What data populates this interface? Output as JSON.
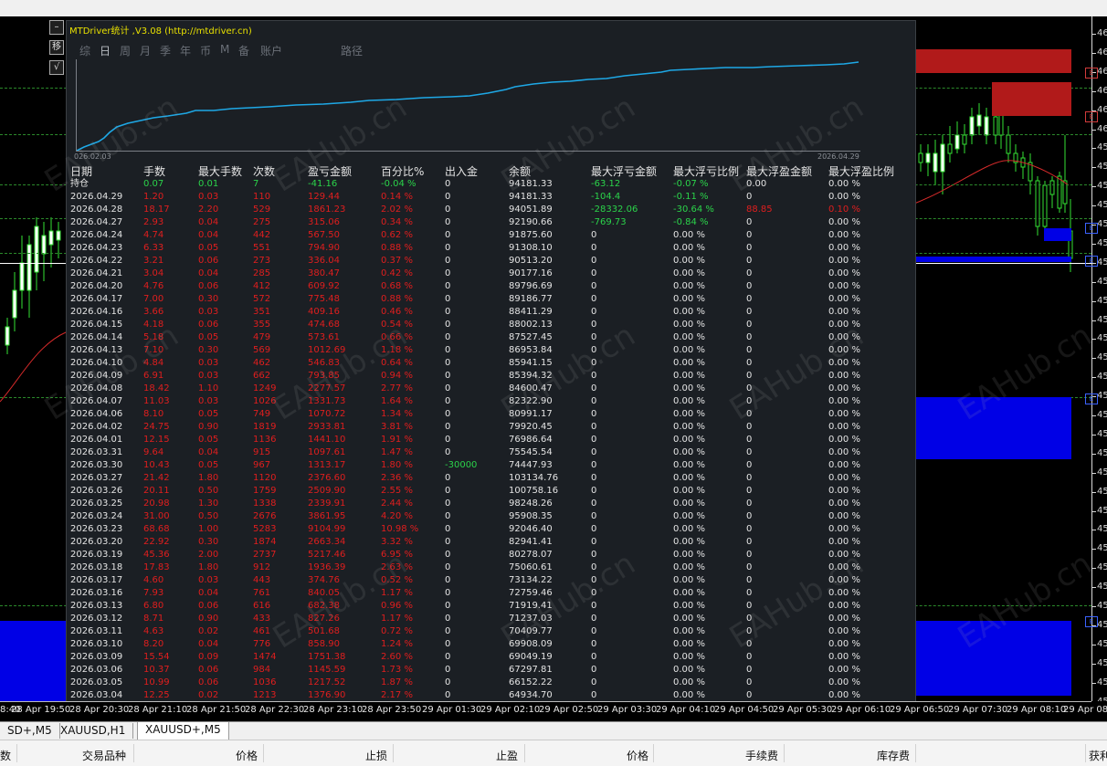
{
  "panel": {
    "title": "MTDriver统计 ,V3.08 (http://mtdriver.cn)",
    "menu": [
      "综",
      "日",
      "周",
      "月",
      "季",
      "年",
      "币",
      "M",
      "备",
      "账户",
      "路径"
    ],
    "active_menu": 1,
    "curve_start": "026.02.03",
    "curve_end": "2026.04.29",
    "curve_color": "#1ea8e6"
  },
  "side_buttons": [
    "–",
    "移",
    "√"
  ],
  "table": {
    "headers": [
      "日期",
      "手数",
      "最大手数",
      "次数",
      "盈亏金额",
      "百分比%",
      "出入金",
      "余额",
      "最大浮亏金额",
      "最大浮亏比例",
      "最大浮盈金额",
      "最大浮盈比例"
    ],
    "rows": [
      {
        "c": [
          "持仓",
          "0.07",
          "0.01",
          "7",
          "-41.16",
          "-0.04 %",
          "0",
          "94181.33",
          "-63.12",
          "-0.07 %",
          "0.00",
          "0.00 %"
        ],
        "k": [
          "w",
          "g",
          "g",
          "g",
          "g",
          "g",
          "w",
          "w",
          "g",
          "g",
          "w",
          "w"
        ]
      },
      {
        "c": [
          "2026.04.29",
          "1.20",
          "0.03",
          "110",
          "129.44",
          "0.14 %",
          "0",
          "94181.33",
          "-104.4",
          "-0.11 %",
          "0",
          "0.00 %"
        ],
        "k": [
          "w",
          "r",
          "r",
          "r",
          "r",
          "r",
          "w",
          "w",
          "g",
          "g",
          "w",
          "w"
        ]
      },
      {
        "c": [
          "2026.04.28",
          "18.17",
          "2.20",
          "529",
          "1861.23",
          "2.02 %",
          "0",
          "94051.89",
          "-28332.06",
          "-30.64 %",
          "88.85",
          "0.10 %"
        ],
        "k": [
          "w",
          "r",
          "r",
          "r",
          "r",
          "r",
          "w",
          "w",
          "g",
          "g",
          "r",
          "r"
        ]
      },
      {
        "c": [
          "2026.04.27",
          "2.93",
          "0.04",
          "275",
          "315.06",
          "0.34 %",
          "0",
          "92190.66",
          "-769.73",
          "-0.84 %",
          "0",
          "0.00 %"
        ],
        "k": [
          "w",
          "r",
          "r",
          "r",
          "r",
          "r",
          "w",
          "w",
          "g",
          "g",
          "w",
          "w"
        ]
      },
      {
        "c": [
          "2026.04.24",
          "4.74",
          "0.04",
          "442",
          "567.50",
          "0.62 %",
          "0",
          "91875.60",
          "0",
          "0.00 %",
          "0",
          "0.00 %"
        ]
      },
      {
        "c": [
          "2026.04.23",
          "6.33",
          "0.05",
          "551",
          "794.90",
          "0.88 %",
          "0",
          "91308.10",
          "0",
          "0.00 %",
          "0",
          "0.00 %"
        ]
      },
      {
        "c": [
          "2026.04.22",
          "3.21",
          "0.06",
          "273",
          "336.04",
          "0.37 %",
          "0",
          "90513.20",
          "0",
          "0.00 %",
          "0",
          "0.00 %"
        ]
      },
      {
        "c": [
          "2026.04.21",
          "3.04",
          "0.04",
          "285",
          "380.47",
          "0.42 %",
          "0",
          "90177.16",
          "0",
          "0.00 %",
          "0",
          "0.00 %"
        ]
      },
      {
        "c": [
          "2026.04.20",
          "4.76",
          "0.06",
          "412",
          "609.92",
          "0.68 %",
          "0",
          "89796.69",
          "0",
          "0.00 %",
          "0",
          "0.00 %"
        ]
      },
      {
        "c": [
          "2026.04.17",
          "7.00",
          "0.30",
          "572",
          "775.48",
          "0.88 %",
          "0",
          "89186.77",
          "0",
          "0.00 %",
          "0",
          "0.00 %"
        ]
      },
      {
        "c": [
          "2026.04.16",
          "3.66",
          "0.03",
          "351",
          "409.16",
          "0.46 %",
          "0",
          "88411.29",
          "0",
          "0.00 %",
          "0",
          "0.00 %"
        ]
      },
      {
        "c": [
          "2026.04.15",
          "4.18",
          "0.06",
          "355",
          "474.68",
          "0.54 %",
          "0",
          "88002.13",
          "0",
          "0.00 %",
          "0",
          "0.00 %"
        ]
      },
      {
        "c": [
          "2026.04.14",
          "5.18",
          "0.05",
          "479",
          "573.61",
          "0.66 %",
          "0",
          "87527.45",
          "0",
          "0.00 %",
          "0",
          "0.00 %"
        ]
      },
      {
        "c": [
          "2026.04.13",
          "7.10",
          "0.30",
          "569",
          "1012.69",
          "1.18 %",
          "0",
          "86953.84",
          "0",
          "0.00 %",
          "0",
          "0.00 %"
        ]
      },
      {
        "c": [
          "2026.04.10",
          "4.84",
          "0.03",
          "462",
          "546.83",
          "0.64 %",
          "0",
          "85941.15",
          "0",
          "0.00 %",
          "0",
          "0.00 %"
        ]
      },
      {
        "c": [
          "2026.04.09",
          "6.91",
          "0.03",
          "662",
          "793.85",
          "0.94 %",
          "0",
          "85394.32",
          "0",
          "0.00 %",
          "0",
          "0.00 %"
        ]
      },
      {
        "c": [
          "2026.04.08",
          "18.42",
          "1.10",
          "1249",
          "2277.57",
          "2.77 %",
          "0",
          "84600.47",
          "0",
          "0.00 %",
          "0",
          "0.00 %"
        ]
      },
      {
        "c": [
          "2026.04.07",
          "11.03",
          "0.03",
          "1026",
          "1331.73",
          "1.64 %",
          "0",
          "82322.90",
          "0",
          "0.00 %",
          "0",
          "0.00 %"
        ]
      },
      {
        "c": [
          "2026.04.06",
          "8.10",
          "0.05",
          "749",
          "1070.72",
          "1.34 %",
          "0",
          "80991.17",
          "0",
          "0.00 %",
          "0",
          "0.00 %"
        ]
      },
      {
        "c": [
          "2026.04.02",
          "24.75",
          "0.90",
          "1819",
          "2933.81",
          "3.81 %",
          "0",
          "79920.45",
          "0",
          "0.00 %",
          "0",
          "0.00 %"
        ]
      },
      {
        "c": [
          "2026.04.01",
          "12.15",
          "0.05",
          "1136",
          "1441.10",
          "1.91 %",
          "0",
          "76986.64",
          "0",
          "0.00 %",
          "0",
          "0.00 %"
        ]
      },
      {
        "c": [
          "2026.03.31",
          "9.64",
          "0.04",
          "915",
          "1097.61",
          "1.47 %",
          "0",
          "75545.54",
          "0",
          "0.00 %",
          "0",
          "0.00 %"
        ]
      },
      {
        "c": [
          "2026.03.30",
          "10.43",
          "0.05",
          "967",
          "1313.17",
          "1.80 %",
          "-30000",
          "74447.93",
          "0",
          "0.00 %",
          "0",
          "0.00 %"
        ],
        "k": [
          "w",
          "r",
          "r",
          "r",
          "r",
          "r",
          "g",
          "w",
          "w",
          "w",
          "w",
          "w"
        ]
      },
      {
        "c": [
          "2026.03.27",
          "21.42",
          "1.80",
          "1120",
          "2376.60",
          "2.36 %",
          "0",
          "103134.76",
          "0",
          "0.00 %",
          "0",
          "0.00 %"
        ]
      },
      {
        "c": [
          "2026.03.26",
          "20.11",
          "0.50",
          "1759",
          "2509.90",
          "2.55 %",
          "0",
          "100758.16",
          "0",
          "0.00 %",
          "0",
          "0.00 %"
        ]
      },
      {
        "c": [
          "2026.03.25",
          "20.98",
          "1.30",
          "1338",
          "2339.91",
          "2.44 %",
          "0",
          "98248.26",
          "0",
          "0.00 %",
          "0",
          "0.00 %"
        ]
      },
      {
        "c": [
          "2026.03.24",
          "31.00",
          "0.50",
          "2676",
          "3861.95",
          "4.20 %",
          "0",
          "95908.35",
          "0",
          "0.00 %",
          "0",
          "0.00 %"
        ]
      },
      {
        "c": [
          "2026.03.23",
          "68.68",
          "1.00",
          "5283",
          "9104.99",
          "10.98 %",
          "0",
          "92046.40",
          "0",
          "0.00 %",
          "0",
          "0.00 %"
        ]
      },
      {
        "c": [
          "2026.03.20",
          "22.92",
          "0.30",
          "1874",
          "2663.34",
          "3.32 %",
          "0",
          "82941.41",
          "0",
          "0.00 %",
          "0",
          "0.00 %"
        ]
      },
      {
        "c": [
          "2026.03.19",
          "45.36",
          "2.00",
          "2737",
          "5217.46",
          "6.95 %",
          "0",
          "80278.07",
          "0",
          "0.00 %",
          "0",
          "0.00 %"
        ]
      },
      {
        "c": [
          "2026.03.18",
          "17.83",
          "1.80",
          "912",
          "1936.39",
          "2.63 %",
          "0",
          "75060.61",
          "0",
          "0.00 %",
          "0",
          "0.00 %"
        ]
      },
      {
        "c": [
          "2026.03.17",
          "4.60",
          "0.03",
          "443",
          "374.76",
          "0.52 %",
          "0",
          "73134.22",
          "0",
          "0.00 %",
          "0",
          "0.00 %"
        ]
      },
      {
        "c": [
          "2026.03.16",
          "7.93",
          "0.04",
          "761",
          "840.05",
          "1.17 %",
          "0",
          "72759.46",
          "0",
          "0.00 %",
          "0",
          "0.00 %"
        ]
      },
      {
        "c": [
          "2026.03.13",
          "6.80",
          "0.06",
          "616",
          "682.38",
          "0.96 %",
          "0",
          "71919.41",
          "0",
          "0.00 %",
          "0",
          "0.00 %"
        ]
      },
      {
        "c": [
          "2026.03.12",
          "8.71",
          "0.90",
          "433",
          "827.26",
          "1.17 %",
          "0",
          "71237.03",
          "0",
          "0.00 %",
          "0",
          "0.00 %"
        ]
      },
      {
        "c": [
          "2026.03.11",
          "4.63",
          "0.02",
          "461",
          "501.68",
          "0.72 %",
          "0",
          "70409.77",
          "0",
          "0.00 %",
          "0",
          "0.00 %"
        ]
      },
      {
        "c": [
          "2026.03.10",
          "8.20",
          "0.04",
          "776",
          "858.90",
          "1.24 %",
          "0",
          "69908.09",
          "0",
          "0.00 %",
          "0",
          "0.00 %"
        ]
      },
      {
        "c": [
          "2026.03.09",
          "15.54",
          "0.09",
          "1474",
          "1751.38",
          "2.60 %",
          "0",
          "69049.19",
          "0",
          "0.00 %",
          "0",
          "0.00 %"
        ]
      },
      {
        "c": [
          "2026.03.06",
          "10.37",
          "0.06",
          "984",
          "1145.59",
          "1.73 %",
          "0",
          "67297.81",
          "0",
          "0.00 %",
          "0",
          "0.00 %"
        ]
      },
      {
        "c": [
          "2026.03.05",
          "10.99",
          "0.06",
          "1036",
          "1217.52",
          "1.87 %",
          "0",
          "66152.22",
          "0",
          "0.00 %",
          "0",
          "0.00 %"
        ]
      },
      {
        "c": [
          "2026.03.04",
          "12.25",
          "0.02",
          "1213",
          "1376.90",
          "2.17 %",
          "0",
          "64934.70",
          "0",
          "0.00 %",
          "0",
          "0.00 %"
        ]
      }
    ]
  },
  "time_axis": [
    "8:40",
    "28 Apr 19:50",
    "28 Apr 20:30",
    "28 Apr 21:10",
    "28 Apr 21:50",
    "28 Apr 22:30",
    "28 Apr 23:10",
    "28 Apr 23:50",
    "29 Apr 01:30",
    "29 Apr 02:10",
    "29 Apr 02:50",
    "29 Apr 03:30",
    "29 Apr 04:10",
    "29 Apr 04:50",
    "29 Apr 05:30",
    "29 Apr 06:10",
    "29 Apr 06:50",
    "29 Apr 07:30",
    "29 Apr 08:10",
    "29 Apr 08:5"
  ],
  "price_scale": [
    "46",
    "46",
    "46",
    "46",
    "46",
    "46",
    "45",
    "45",
    "45",
    "45",
    "45",
    "45",
    "45",
    "45",
    "45",
    "45",
    "45",
    "45",
    "45",
    "45",
    "45",
    "45",
    "45",
    "45",
    "45",
    "45",
    "45",
    "45",
    "45",
    "45",
    "45",
    "45",
    "45",
    "45",
    "45",
    "45"
  ],
  "tabs": [
    "SD+,M5",
    "XAUUSD,H1",
    "XAUUSD+,M5"
  ],
  "active_tab": 2,
  "terminal_headers": [
    "数",
    "交易品种",
    "价格",
    "止损",
    "止盈",
    "价格",
    "手续费",
    "库存费",
    "获利"
  ],
  "watermark": "EAHub.cn",
  "colors": {
    "red": "#e01e1e",
    "green": "#2bd34a",
    "title": "#e8e000",
    "zone_blue": "#0000e6",
    "zone_red": "#b11a1a"
  }
}
